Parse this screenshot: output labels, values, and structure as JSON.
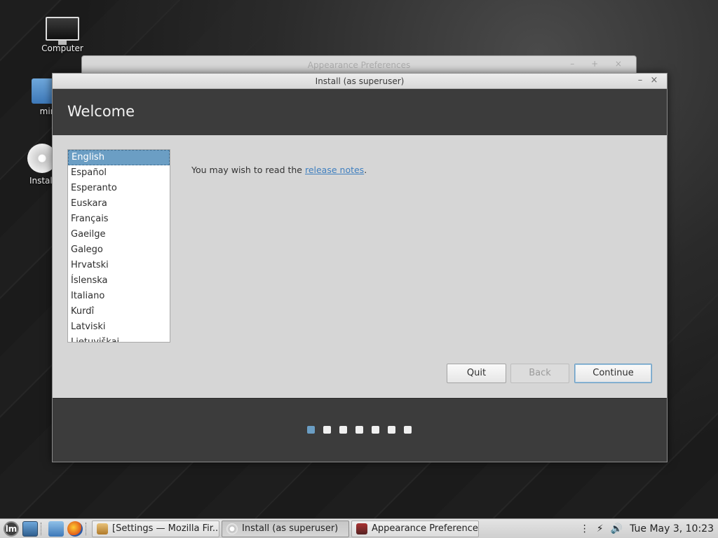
{
  "desktop": {
    "icons": [
      {
        "label": "Computer"
      },
      {
        "label": "min"
      },
      {
        "label": "Install"
      }
    ]
  },
  "background_window": {
    "title": "Appearance Preferences",
    "controls": "– + ×"
  },
  "window": {
    "title": "Install (as superuser)",
    "minimize": "–",
    "close": "×",
    "heading": "Welcome",
    "languages": [
      "English",
      "Español",
      "Esperanto",
      "Euskara",
      "Français",
      "Gaeilge",
      "Galego",
      "Hrvatski",
      "Íslenska",
      "Italiano",
      "Kurdî",
      "Latviski",
      "Lietuviškai"
    ],
    "selected_language": "English",
    "notes_prefix": "You may wish to read the ",
    "notes_link": "release notes",
    "notes_suffix": ".",
    "buttons": {
      "quit": "Quit",
      "back": "Back",
      "continue": "Continue"
    },
    "progress": {
      "steps": 7,
      "current": 1
    }
  },
  "taskbar": {
    "mint_glyph": "lm",
    "tasks": [
      {
        "label": "[Settings — Mozilla Fir..."
      },
      {
        "label": "Install (as superuser)"
      },
      {
        "label": "Appearance Preferences"
      }
    ],
    "clock": "Tue May  3, 10:23"
  },
  "colors": {
    "accent": "#6b9ec4",
    "header_bg": "#3c3c3c",
    "link": "#3f7fbf"
  }
}
